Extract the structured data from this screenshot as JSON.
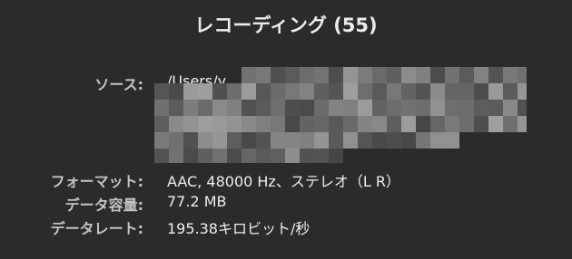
{
  "window": {
    "title": "レコーディング (55)"
  },
  "info": {
    "source_label": "ソース:",
    "source_value": "/Users/y",
    "format_label": "フォーマット:",
    "format_value": "AAC, 48000 Hz、ステレオ（L R）",
    "size_label": "データ容量:",
    "size_value": "77.2 MB",
    "rate_label": "データレート:",
    "rate_value": "195.38キロビット/秒"
  }
}
